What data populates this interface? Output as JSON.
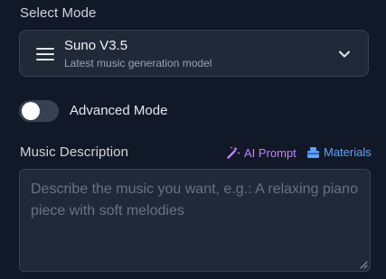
{
  "mode_section": {
    "label": "Select Mode",
    "selected_name": "Suno V3.5",
    "selected_description": "Latest music generation model",
    "menu_icon": "hamburger-menu-icon",
    "dropdown_icon": "chevron-down-icon"
  },
  "advanced_toggle": {
    "label": "Advanced Mode",
    "enabled": false
  },
  "description_section": {
    "label": "Music Description",
    "ai_prompt_label": "AI Prompt",
    "ai_prompt_icon": "magic-wand-icon",
    "materials_label": "Materials",
    "materials_icon": "layers-icon",
    "placeholder": "Describe the music you want, e.g.: A relaxing piano piece with soft melodies",
    "value": ""
  },
  "colors": {
    "background": "#111827",
    "surface": "#1f2937",
    "border": "#374151",
    "ai_prompt_accent": "#c084fc",
    "materials_accent": "#60a5fa"
  }
}
